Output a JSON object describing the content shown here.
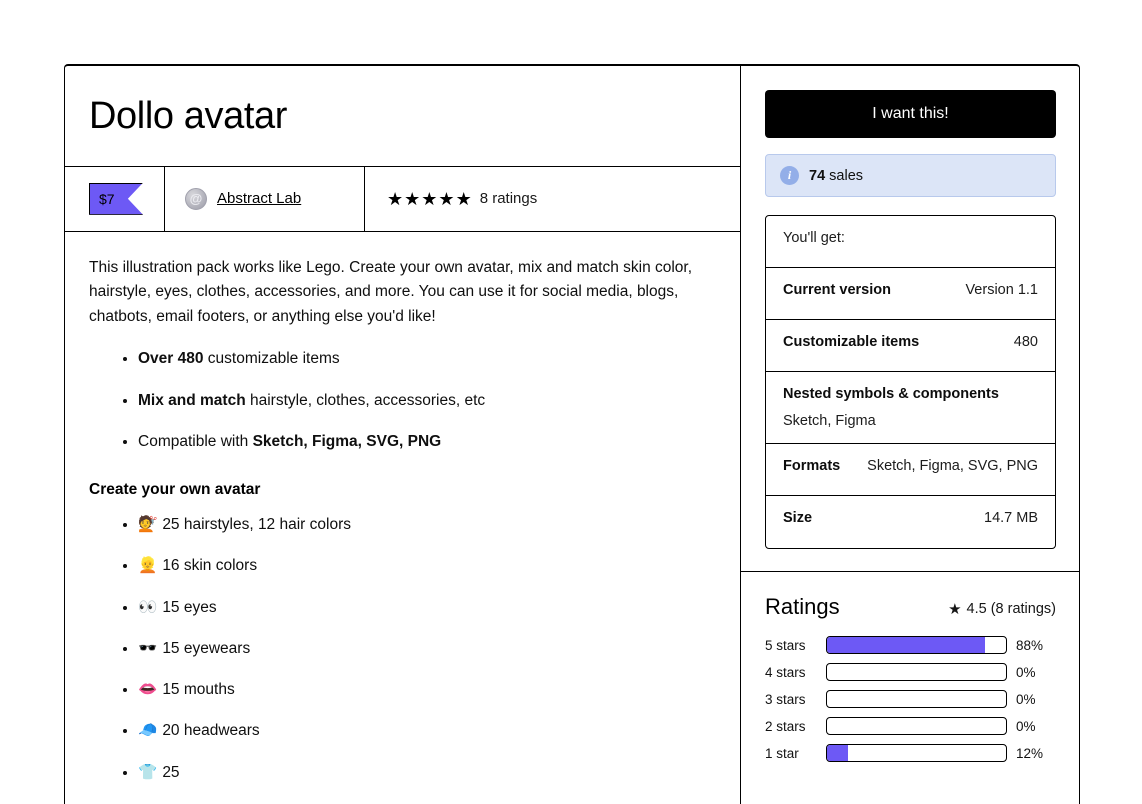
{
  "product": {
    "title": "Dollo avatar",
    "price": "$7",
    "creator": "Abstract Lab",
    "creator_avatar_glyph": "@",
    "stars_filled": 5,
    "ratings_label": "8 ratings"
  },
  "description": {
    "paragraph": "This illustration pack works like Lego. Create your own avatar, mix and match skin color, hairstyle, eyes, clothes, accessories, and more. You can use it for social media, blogs, chatbots, email footers, or anything else you'd like!",
    "feature_bullets": [
      {
        "bold": "Over 480",
        "rest": " customizable items"
      },
      {
        "bold": "Mix and match",
        "rest": " hairstyle, clothes, accessories, etc"
      },
      {
        "pre": "Compatible with ",
        "bold": "Sketch, Figma, SVG, PNG",
        "rest": ""
      }
    ],
    "section_heading": "Create your own avatar",
    "avatar_items": [
      {
        "emoji": "💇",
        "text": "25 hairstyles, 12 hair colors"
      },
      {
        "emoji": "👱",
        "text": "16 skin colors"
      },
      {
        "emoji": "👀",
        "text": "15 eyes"
      },
      {
        "emoji": "🕶️",
        "text": "15 eyewears"
      },
      {
        "emoji": "👄",
        "text": "15 mouths"
      },
      {
        "emoji": "🧢",
        "text": "20 headwears"
      },
      {
        "emoji": "👕",
        "text": "25"
      }
    ]
  },
  "sidebar": {
    "buy_button_label": "I want this!",
    "sales_count": "74",
    "sales_suffix": " sales",
    "youll_get_label": "You'll get:",
    "details": [
      {
        "label": "Current version",
        "value": "Version 1.1",
        "stacked": false
      },
      {
        "label": "Customizable items",
        "value": "480",
        "stacked": false
      },
      {
        "label": "Nested symbols & components",
        "value": "Sketch, Figma",
        "stacked": true
      },
      {
        "label": "Formats",
        "value": "Sketch, Figma, SVG, PNG",
        "stacked": false
      },
      {
        "label": "Size",
        "value": "14.7 MB",
        "stacked": false
      }
    ]
  },
  "ratings": {
    "title": "Ratings",
    "star_glyph": "★",
    "average": "4.5",
    "summary": "4.5 (8 ratings)",
    "histogram": [
      {
        "label": "5 stars",
        "pct": "88%",
        "value": 88
      },
      {
        "label": "4 stars",
        "pct": "0%",
        "value": 0
      },
      {
        "label": "3 stars",
        "pct": "0%",
        "value": 0
      },
      {
        "label": "2 stars",
        "pct": "0%",
        "value": 0
      },
      {
        "label": "1 star",
        "pct": "12%",
        "value": 12
      }
    ]
  },
  "colors": {
    "accent_purple": "#6d59f5",
    "badge_background": "#dce5f7",
    "badge_icon": "#93aee8",
    "button_background": "#000000"
  }
}
